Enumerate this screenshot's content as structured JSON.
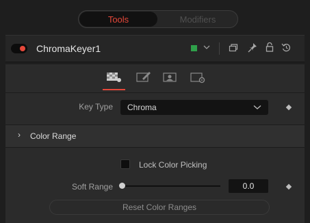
{
  "top_tabs": {
    "tools": "Tools",
    "modifiers": "Modifiers",
    "active": "Tools"
  },
  "node": {
    "name": "ChromaKeyer1",
    "color_chip": "#2fa04a",
    "enabled": true
  },
  "header_icons": [
    "color-dropdown-chevron",
    "versions-icon",
    "pin-icon",
    "lock-icon",
    "reset-icon"
  ],
  "inspector_tabs": [
    "key-tab",
    "pre-matte-tab",
    "image-tab",
    "settings-tab"
  ],
  "controls": {
    "key_type": {
      "label": "Key Type",
      "value": "Chroma"
    },
    "color_range_section": "Color Range",
    "lock_color_picking": {
      "label": "Lock Color Picking",
      "checked": false
    },
    "soft_range": {
      "label": "Soft Range",
      "value": "0.0",
      "fraction": 0.0
    },
    "reset_button": "Reset Color Ranges"
  },
  "colors": {
    "accent": "#e5483a",
    "background": "#1e1e1e",
    "panel": "#2b2b2b"
  }
}
